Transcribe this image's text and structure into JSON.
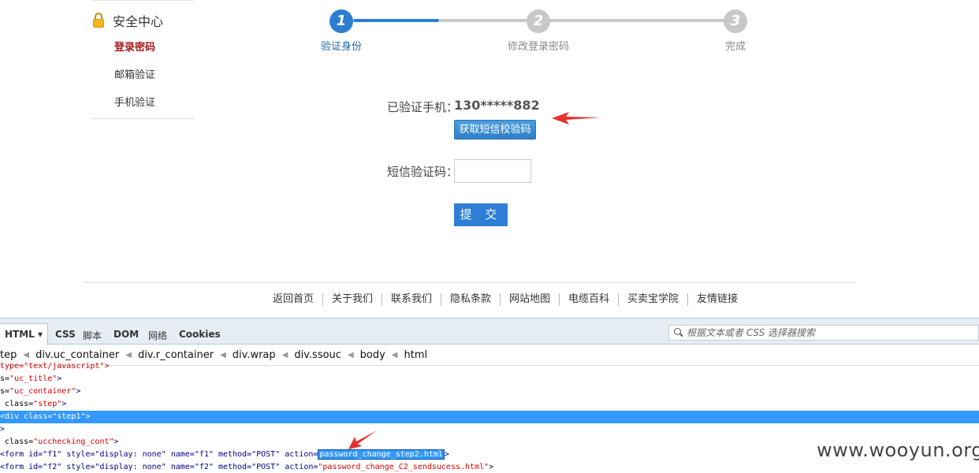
{
  "sidebar": {
    "title": "安全中心",
    "items": [
      {
        "label": "登录密码"
      },
      {
        "label": "邮箱验证"
      },
      {
        "label": "手机验证"
      }
    ]
  },
  "steps": [
    {
      "number": "1",
      "label": "验证身份",
      "state": "active"
    },
    {
      "number": "2",
      "label": "修改登录密码",
      "state": "inactive"
    },
    {
      "number": "3",
      "label": "完成",
      "state": "inactive"
    }
  ],
  "form": {
    "verified_phone_label": "已验证手机：",
    "phone_value": "130*****882",
    "sms_button_label": "获取短信校验码",
    "sms_code_label": "短信验证码：",
    "sms_code_value": "",
    "submit_label": "提 交"
  },
  "footer": {
    "links": [
      "返回首页",
      "关于我们",
      "联系我们",
      "隐私条款",
      "网站地图",
      "电缆百科",
      "买卖宝学院",
      "友情链接"
    ]
  },
  "devtools": {
    "tabs": [
      "HTML ▾",
      "CSS",
      "脚本",
      "DOM",
      "网络",
      "Cookies"
    ],
    "search_placeholder": "根据文本或者 CSS 选择器搜索",
    "breadcrumb": [
      "tep",
      "div.uc_container",
      "div.r_container",
      "div.wrap",
      "div.ssouc",
      "body",
      "html"
    ],
    "code_lines": [
      {
        "t1": "type=\"text/javascript\">",
        "c1": "",
        "t2": ""
      },
      {
        "t1": "s=",
        "c1": "\"uc_title\"",
        "t2": ">"
      },
      {
        "t1": "s=",
        "c1": "\"uc_container\"",
        "t2": ">"
      },
      {
        "t1": " class=",
        "c1": "\"step\"",
        "t2": ">"
      },
      {
        "t1": "<div class=\"step1\">",
        "c1": "",
        "t2": ""
      },
      {
        "t1": ">",
        "c1": "",
        "t2": ""
      },
      {
        "t1": " class=",
        "c1": "\"ucchecking_cont\"",
        "t2": ">"
      },
      {
        "t1": "<form id=\"f1\" style=\"display: none\" name=\"f1\" method=\"POST\" action=",
        "c1": "password_change_step2.html",
        "t2": ">"
      },
      {
        "t1": "<form id=\"f2\" style=\"display: none\" name=\"f2\" method=\"POST\" action=",
        "c1": "\"password_change_C2_sendsucess.html\"",
        "t2": ">"
      }
    ]
  },
  "watermark": "www.wooyun.org",
  "colors": {
    "step_active": "#2c7fd0",
    "step_inactive": "#c8c8c8",
    "sidebar_active": "#a51d1d",
    "button_blue": "#2d7ed4",
    "selection": "#3399ff",
    "arrow_red": "#e83030"
  }
}
